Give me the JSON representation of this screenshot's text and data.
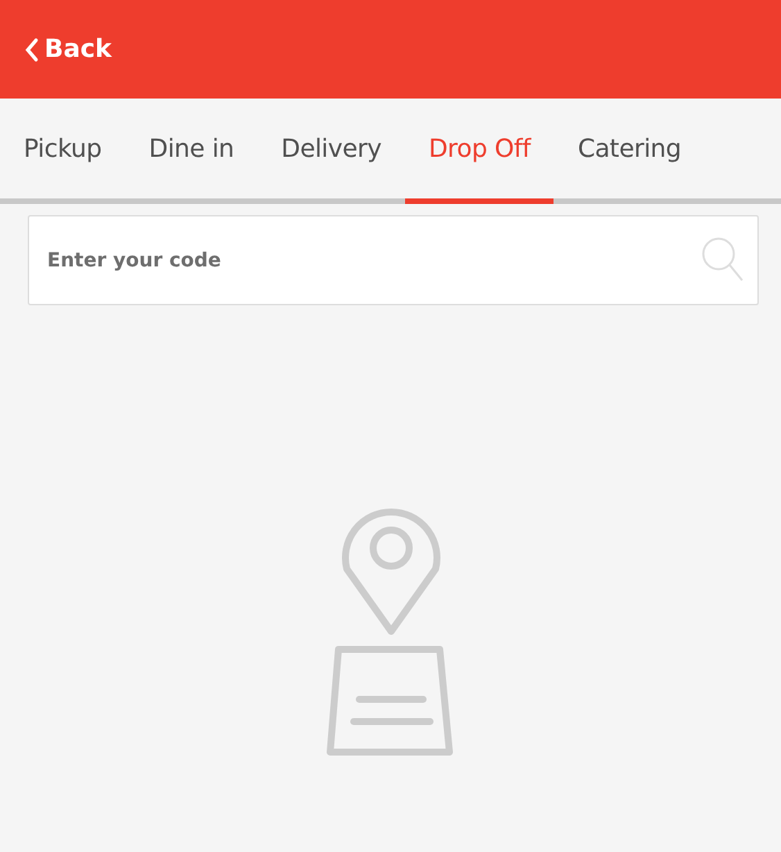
{
  "header": {
    "back_label": "Back"
  },
  "tabs": [
    {
      "label": "Pickup",
      "selected": false
    },
    {
      "label": "Dine in",
      "selected": false
    },
    {
      "label": "Delivery",
      "selected": false
    },
    {
      "label": "Drop Off",
      "selected": true
    },
    {
      "label": "Catering",
      "selected": false
    }
  ],
  "search": {
    "placeholder": "Enter your code"
  }
}
